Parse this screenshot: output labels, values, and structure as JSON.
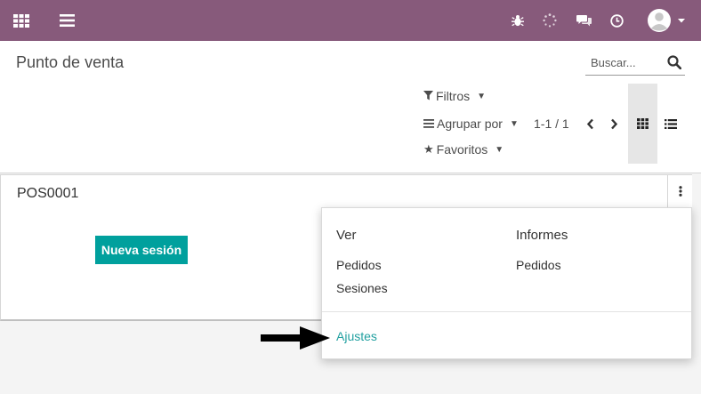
{
  "topbar": {
    "apps_icon": "grid-icon",
    "menu_icon": "hamburger-icon",
    "debug_icon": "bug-icon",
    "activity_icon": "spinner-icon",
    "chat_icon": "chat-icon",
    "clock_icon": "clock-icon",
    "avatar_icon": "avatar-icon"
  },
  "control_panel": {
    "title": "Punto de venta",
    "search_placeholder": "Buscar...",
    "filters_label": "Filtros",
    "group_by_label": "Agrupar por",
    "favorites_label": "Favoritos",
    "pager": "1-1 / 1"
  },
  "card": {
    "name": "POS0001",
    "new_session_label": "Nueva sesión"
  },
  "dropdown": {
    "view_heading": "Ver",
    "view_items": [
      "Pedidos",
      "Sesiones"
    ],
    "reports_heading": "Informes",
    "reports_items": [
      "Pedidos"
    ],
    "settings_link": "Ajustes"
  },
  "colors": {
    "topbar": "#875a7b",
    "primary_button": "#00a09d",
    "link": "#21a0a0"
  }
}
